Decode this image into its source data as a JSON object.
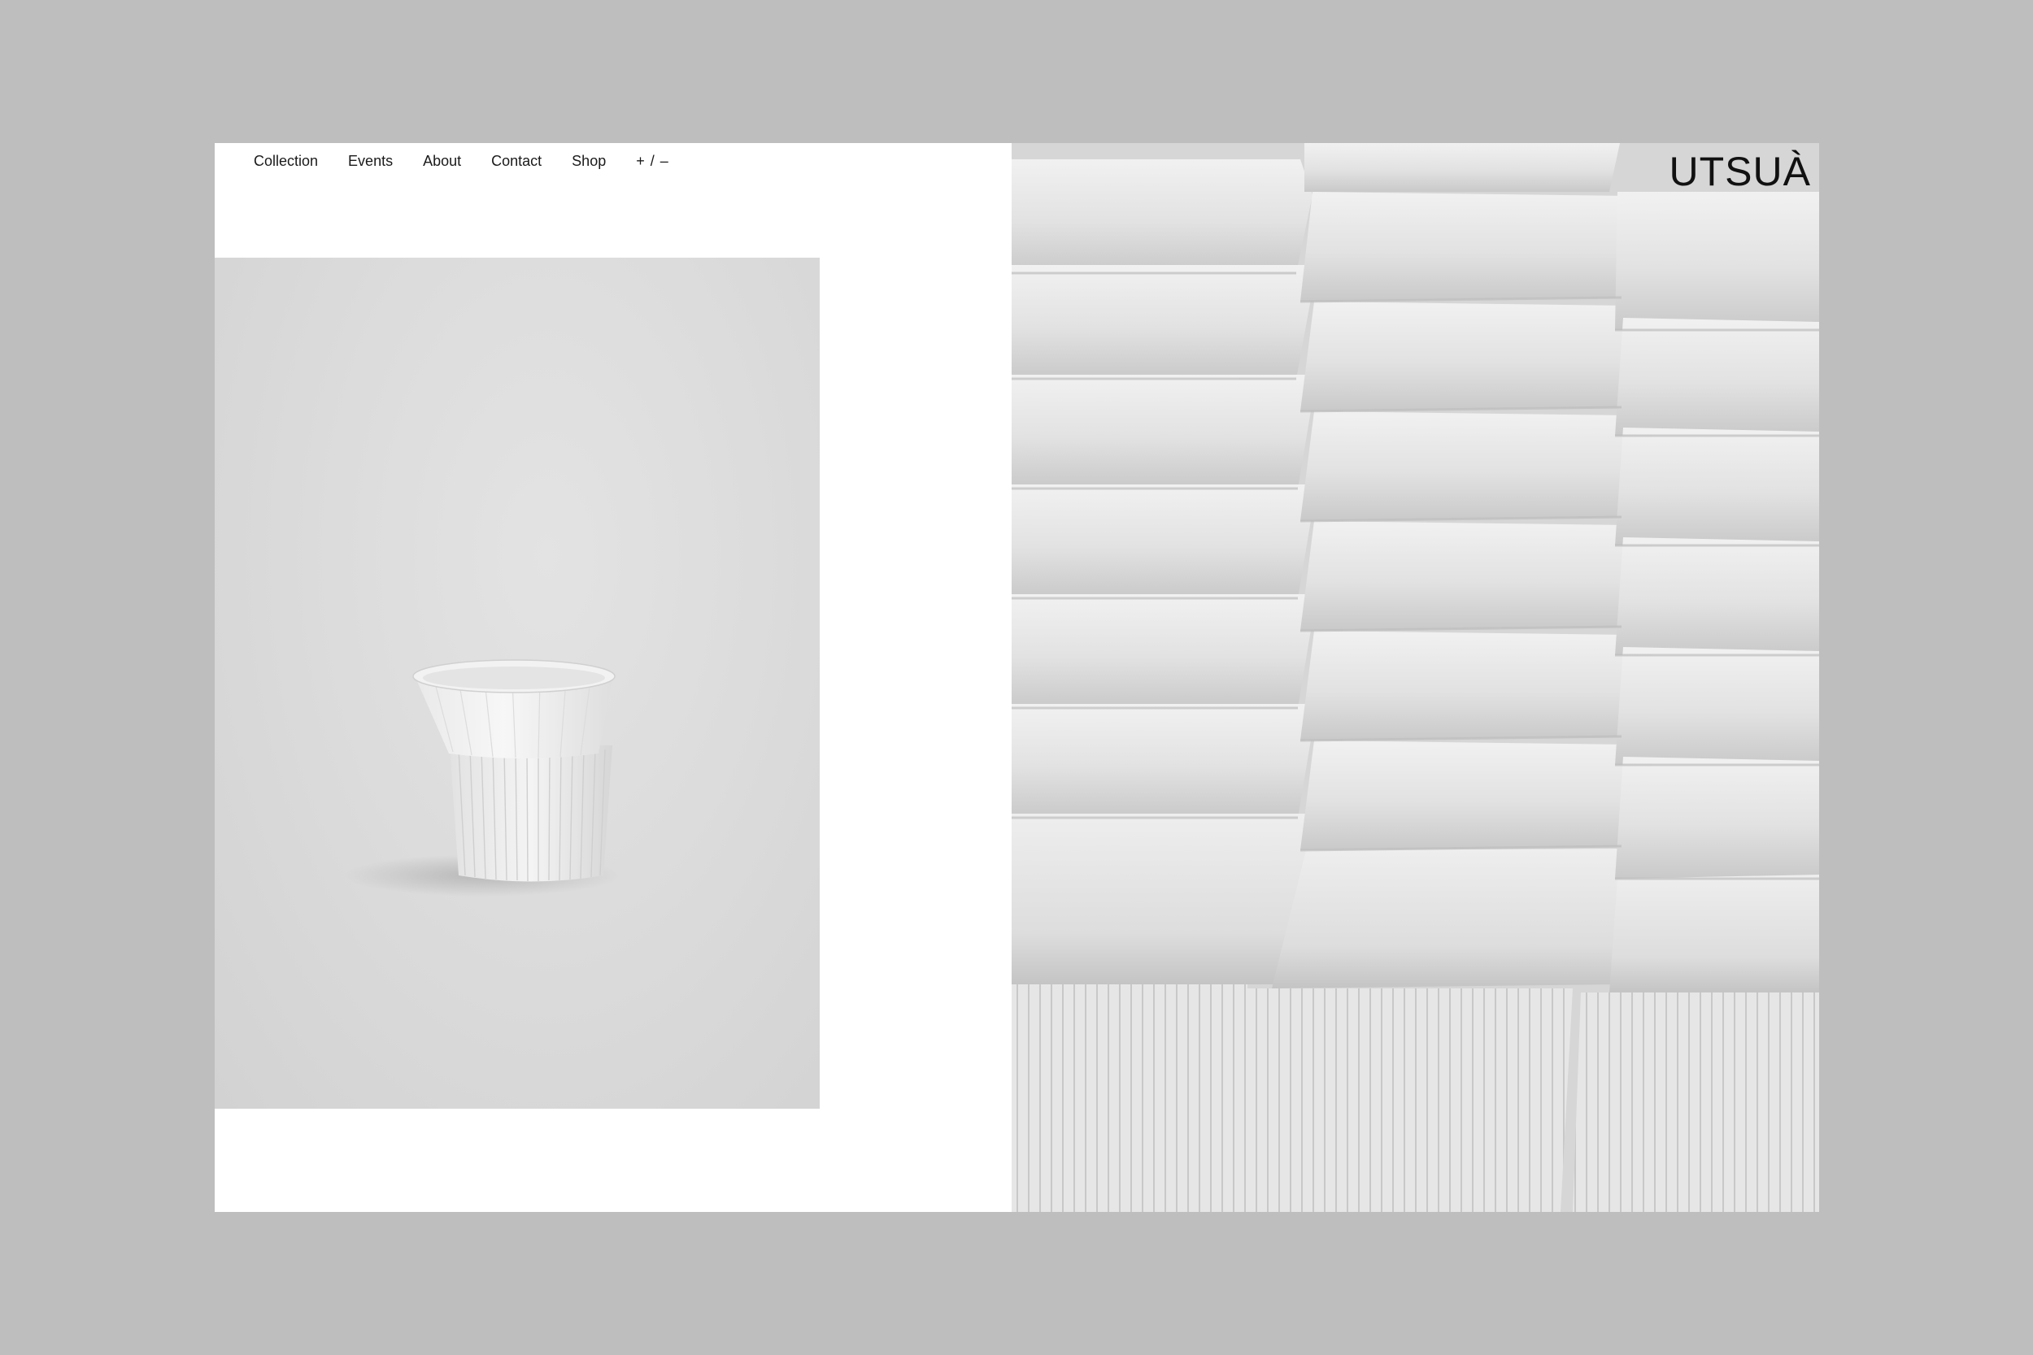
{
  "nav": {
    "items": [
      {
        "label": "Collection"
      },
      {
        "label": "Events"
      },
      {
        "label": "About"
      },
      {
        "label": "Contact"
      },
      {
        "label": "Shop"
      }
    ],
    "toggle_label": "+ / –"
  },
  "brand": {
    "name": "UTSUÀ"
  },
  "colors": {
    "background": "#bebebe",
    "panel": "#ffffff",
    "text": "#111111"
  },
  "icons": {
    "product": "ceramic-cup-image",
    "hero": "stacked-cups-image"
  }
}
